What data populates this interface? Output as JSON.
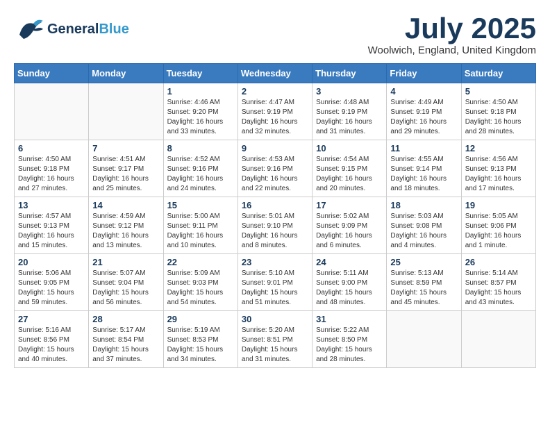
{
  "app": {
    "name": "GeneralBlue",
    "name_part1": "General",
    "name_part2": "Blue"
  },
  "title": "July 2025",
  "location": "Woolwich, England, United Kingdom",
  "days_of_week": [
    "Sunday",
    "Monday",
    "Tuesday",
    "Wednesday",
    "Thursday",
    "Friday",
    "Saturday"
  ],
  "weeks": [
    [
      {
        "day": "",
        "sunrise": "",
        "sunset": "",
        "daylight": ""
      },
      {
        "day": "",
        "sunrise": "",
        "sunset": "",
        "daylight": ""
      },
      {
        "day": "1",
        "sunrise": "Sunrise: 4:46 AM",
        "sunset": "Sunset: 9:20 PM",
        "daylight": "Daylight: 16 hours and 33 minutes."
      },
      {
        "day": "2",
        "sunrise": "Sunrise: 4:47 AM",
        "sunset": "Sunset: 9:19 PM",
        "daylight": "Daylight: 16 hours and 32 minutes."
      },
      {
        "day": "3",
        "sunrise": "Sunrise: 4:48 AM",
        "sunset": "Sunset: 9:19 PM",
        "daylight": "Daylight: 16 hours and 31 minutes."
      },
      {
        "day": "4",
        "sunrise": "Sunrise: 4:49 AM",
        "sunset": "Sunset: 9:19 PM",
        "daylight": "Daylight: 16 hours and 29 minutes."
      },
      {
        "day": "5",
        "sunrise": "Sunrise: 4:50 AM",
        "sunset": "Sunset: 9:18 PM",
        "daylight": "Daylight: 16 hours and 28 minutes."
      }
    ],
    [
      {
        "day": "6",
        "sunrise": "Sunrise: 4:50 AM",
        "sunset": "Sunset: 9:18 PM",
        "daylight": "Daylight: 16 hours and 27 minutes."
      },
      {
        "day": "7",
        "sunrise": "Sunrise: 4:51 AM",
        "sunset": "Sunset: 9:17 PM",
        "daylight": "Daylight: 16 hours and 25 minutes."
      },
      {
        "day": "8",
        "sunrise": "Sunrise: 4:52 AM",
        "sunset": "Sunset: 9:16 PM",
        "daylight": "Daylight: 16 hours and 24 minutes."
      },
      {
        "day": "9",
        "sunrise": "Sunrise: 4:53 AM",
        "sunset": "Sunset: 9:16 PM",
        "daylight": "Daylight: 16 hours and 22 minutes."
      },
      {
        "day": "10",
        "sunrise": "Sunrise: 4:54 AM",
        "sunset": "Sunset: 9:15 PM",
        "daylight": "Daylight: 16 hours and 20 minutes."
      },
      {
        "day": "11",
        "sunrise": "Sunrise: 4:55 AM",
        "sunset": "Sunset: 9:14 PM",
        "daylight": "Daylight: 16 hours and 18 minutes."
      },
      {
        "day": "12",
        "sunrise": "Sunrise: 4:56 AM",
        "sunset": "Sunset: 9:13 PM",
        "daylight": "Daylight: 16 hours and 17 minutes."
      }
    ],
    [
      {
        "day": "13",
        "sunrise": "Sunrise: 4:57 AM",
        "sunset": "Sunset: 9:13 PM",
        "daylight": "Daylight: 16 hours and 15 minutes."
      },
      {
        "day": "14",
        "sunrise": "Sunrise: 4:59 AM",
        "sunset": "Sunset: 9:12 PM",
        "daylight": "Daylight: 16 hours and 13 minutes."
      },
      {
        "day": "15",
        "sunrise": "Sunrise: 5:00 AM",
        "sunset": "Sunset: 9:11 PM",
        "daylight": "Daylight: 16 hours and 10 minutes."
      },
      {
        "day": "16",
        "sunrise": "Sunrise: 5:01 AM",
        "sunset": "Sunset: 9:10 PM",
        "daylight": "Daylight: 16 hours and 8 minutes."
      },
      {
        "day": "17",
        "sunrise": "Sunrise: 5:02 AM",
        "sunset": "Sunset: 9:09 PM",
        "daylight": "Daylight: 16 hours and 6 minutes."
      },
      {
        "day": "18",
        "sunrise": "Sunrise: 5:03 AM",
        "sunset": "Sunset: 9:08 PM",
        "daylight": "Daylight: 16 hours and 4 minutes."
      },
      {
        "day": "19",
        "sunrise": "Sunrise: 5:05 AM",
        "sunset": "Sunset: 9:06 PM",
        "daylight": "Daylight: 16 hours and 1 minute."
      }
    ],
    [
      {
        "day": "20",
        "sunrise": "Sunrise: 5:06 AM",
        "sunset": "Sunset: 9:05 PM",
        "daylight": "Daylight: 15 hours and 59 minutes."
      },
      {
        "day": "21",
        "sunrise": "Sunrise: 5:07 AM",
        "sunset": "Sunset: 9:04 PM",
        "daylight": "Daylight: 15 hours and 56 minutes."
      },
      {
        "day": "22",
        "sunrise": "Sunrise: 5:09 AM",
        "sunset": "Sunset: 9:03 PM",
        "daylight": "Daylight: 15 hours and 54 minutes."
      },
      {
        "day": "23",
        "sunrise": "Sunrise: 5:10 AM",
        "sunset": "Sunset: 9:01 PM",
        "daylight": "Daylight: 15 hours and 51 minutes."
      },
      {
        "day": "24",
        "sunrise": "Sunrise: 5:11 AM",
        "sunset": "Sunset: 9:00 PM",
        "daylight": "Daylight: 15 hours and 48 minutes."
      },
      {
        "day": "25",
        "sunrise": "Sunrise: 5:13 AM",
        "sunset": "Sunset: 8:59 PM",
        "daylight": "Daylight: 15 hours and 45 minutes."
      },
      {
        "day": "26",
        "sunrise": "Sunrise: 5:14 AM",
        "sunset": "Sunset: 8:57 PM",
        "daylight": "Daylight: 15 hours and 43 minutes."
      }
    ],
    [
      {
        "day": "27",
        "sunrise": "Sunrise: 5:16 AM",
        "sunset": "Sunset: 8:56 PM",
        "daylight": "Daylight: 15 hours and 40 minutes."
      },
      {
        "day": "28",
        "sunrise": "Sunrise: 5:17 AM",
        "sunset": "Sunset: 8:54 PM",
        "daylight": "Daylight: 15 hours and 37 minutes."
      },
      {
        "day": "29",
        "sunrise": "Sunrise: 5:19 AM",
        "sunset": "Sunset: 8:53 PM",
        "daylight": "Daylight: 15 hours and 34 minutes."
      },
      {
        "day": "30",
        "sunrise": "Sunrise: 5:20 AM",
        "sunset": "Sunset: 8:51 PM",
        "daylight": "Daylight: 15 hours and 31 minutes."
      },
      {
        "day": "31",
        "sunrise": "Sunrise: 5:22 AM",
        "sunset": "Sunset: 8:50 PM",
        "daylight": "Daylight: 15 hours and 28 minutes."
      },
      {
        "day": "",
        "sunrise": "",
        "sunset": "",
        "daylight": ""
      },
      {
        "day": "",
        "sunrise": "",
        "sunset": "",
        "daylight": ""
      }
    ]
  ]
}
